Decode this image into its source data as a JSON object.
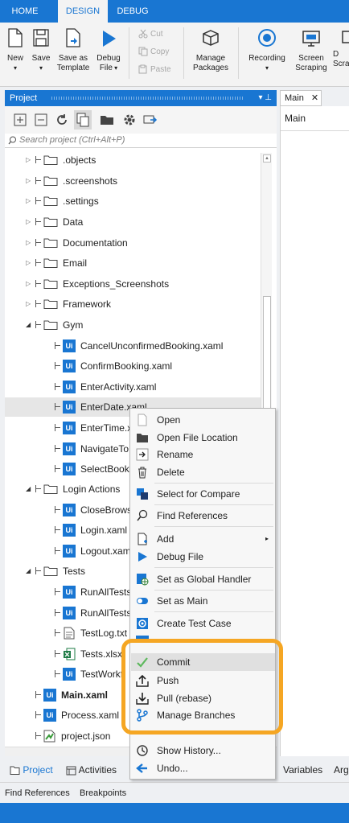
{
  "ribbon_tabs": [
    "HOME",
    "DESIGN",
    "DEBUG"
  ],
  "ribbon": {
    "new": "New",
    "save": "Save",
    "save_as_template": "Save as Template",
    "debug_file": "Debug File",
    "cut": "Cut",
    "copy": "Copy",
    "paste": "Paste",
    "manage_packages": "Manage Packages",
    "recording": "Recording",
    "screen_scraping": "Screen Scraping",
    "partial_1": "D",
    "partial_2": "Scra"
  },
  "project_panel": {
    "title": "Project",
    "pin": "▾ ⊥",
    "search_placeholder": "Search project (Ctrl+Alt+P)",
    "tree": [
      {
        "label": ".objects",
        "kind": "folder",
        "expanded": false
      },
      {
        "label": ".screenshots",
        "kind": "folder",
        "expanded": false
      },
      {
        "label": ".settings",
        "kind": "folder",
        "expanded": false
      },
      {
        "label": "Data",
        "kind": "folder",
        "expanded": false
      },
      {
        "label": "Documentation",
        "kind": "folder",
        "expanded": false
      },
      {
        "label": "Email",
        "kind": "folder",
        "expanded": false
      },
      {
        "label": "Exceptions_Screenshots",
        "kind": "folder",
        "expanded": false
      },
      {
        "label": "Framework",
        "kind": "folder",
        "expanded": false
      },
      {
        "label": "Gym",
        "kind": "folder",
        "expanded": true
      },
      {
        "label": "CancelUnconfirmedBooking.xaml",
        "kind": "xaml"
      },
      {
        "label": "ConfirmBooking.xaml",
        "kind": "xaml"
      },
      {
        "label": "EnterActivity.xaml",
        "kind": "xaml"
      },
      {
        "label": "EnterDate.xaml",
        "kind": "xaml",
        "selected": true
      },
      {
        "label": "EnterTime.x",
        "kind": "xaml"
      },
      {
        "label": "NavigateTo",
        "kind": "xaml"
      },
      {
        "label": "SelectBooki",
        "kind": "xaml"
      },
      {
        "label": "Login Actions",
        "kind": "folder",
        "expanded": true
      },
      {
        "label": "CloseBrows",
        "kind": "xaml"
      },
      {
        "label": "Login.xaml",
        "kind": "xaml"
      },
      {
        "label": "Logout.xam",
        "kind": "xaml"
      },
      {
        "label": "Tests",
        "kind": "folder",
        "expanded": true
      },
      {
        "label": "RunAllTests.",
        "kind": "xaml"
      },
      {
        "label": "RunAllTests",
        "kind": "xaml"
      },
      {
        "label": "TestLog.txt",
        "kind": "txt"
      },
      {
        "label": "Tests.xlsx",
        "kind": "xlsx"
      },
      {
        "label": "TestWorkf",
        "kind": "xaml"
      },
      {
        "label": "Main.xaml",
        "kind": "xaml",
        "bold": true
      },
      {
        "label": "Process.xaml",
        "kind": "xaml"
      },
      {
        "label": "project.json",
        "kind": "json"
      }
    ]
  },
  "bottom_tabs": {
    "project": "Project",
    "activities": "Activities",
    "variables": "Variables",
    "arguments": "Arg"
  },
  "find_bar": {
    "find_references": "Find References",
    "breakpoints": "Breakpoints"
  },
  "designer": {
    "tab_label": "Main",
    "close": "✕",
    "breadcrumb": "Main"
  },
  "context_menu": {
    "open": "Open",
    "open_file_location": "Open File Location",
    "rename": "Rename",
    "delete": "Delete",
    "select_for_compare": "Select for Compare",
    "find_references": "Find References",
    "add": "Add",
    "debug_file": "Debug File",
    "set_as_global_handler": "Set as Global Handler",
    "set_as_main": "Set as Main",
    "create_test_case": "Create Test Case",
    "commit": "Commit",
    "push": "Push",
    "pull_rebase": "Pull (rebase)",
    "manage_branches": "Manage Branches",
    "show_history": "Show History...",
    "undo": "Undo..."
  },
  "colors": {
    "accent": "#1976d2",
    "highlight_ring": "#f5a623",
    "commit_check": "#5cb85c"
  }
}
